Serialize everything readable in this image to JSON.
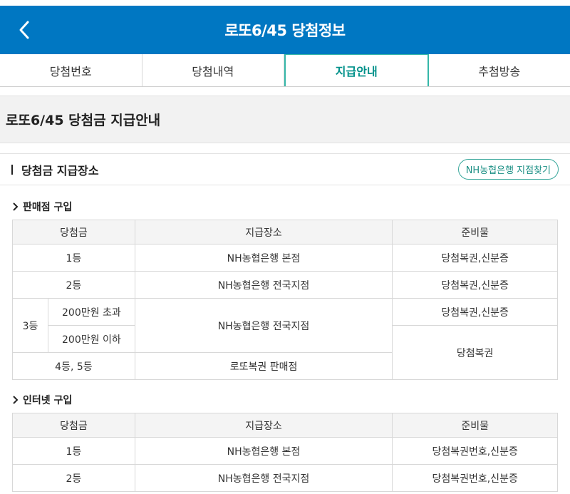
{
  "header": {
    "title": "로또6/45 당첨정보"
  },
  "tabs": [
    {
      "label": "당첨번호"
    },
    {
      "label": "당첨내역"
    },
    {
      "label": "지급안내"
    },
    {
      "label": "추첨방송"
    }
  ],
  "section_title": "로또6/45 당첨금 지급안내",
  "subsection": {
    "title": "당첨금 지급장소",
    "branch_button": "NH농협은행 지점찾기"
  },
  "store": {
    "title": "판매점 구입",
    "headers": [
      "당첨금",
      "지급장소",
      "준비물"
    ],
    "rows": {
      "r1": {
        "prize": "1등",
        "place": "NH농협은행 본점",
        "items": "당첨복권,신분증"
      },
      "r2": {
        "prize": "2등",
        "place": "NH농협은행 전국지점",
        "items": "당첨복권,신분증"
      },
      "r3": {
        "prize": "3등",
        "sub_a": "200만원 초과",
        "sub_b": "200만원 이하",
        "place": "NH농협은행 전국지점",
        "items_a": "당첨복권,신분증",
        "items_b": "당첨복권"
      },
      "r4": {
        "prize": "4등, 5등",
        "place": "로또복권 판매점"
      }
    }
  },
  "internet": {
    "title": "인터넷 구입",
    "headers": [
      "당첨금",
      "지급장소",
      "준비물"
    ],
    "rows": [
      {
        "prize": "1등",
        "place": "NH농협은행 본점",
        "items": "당첨복권번호,신분증"
      },
      {
        "prize": "2등",
        "place": "NH농협은행 전국지점",
        "items": "당첨복권번호,신분증"
      }
    ]
  }
}
